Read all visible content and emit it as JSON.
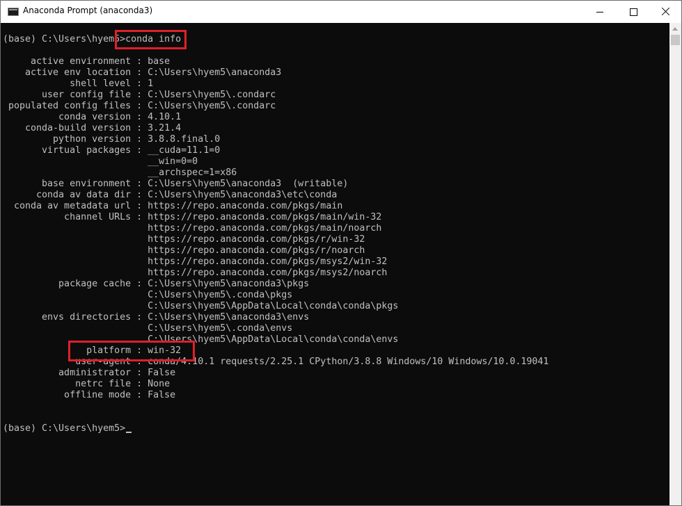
{
  "window": {
    "title": "Anaconda Prompt (anaconda3)",
    "icon": "terminal-icon",
    "controls": {
      "minimize": "minimize-icon",
      "maximize": "maximize-icon",
      "close": "close-icon"
    }
  },
  "console": {
    "lines": [
      "(base) C:\\Users\\hyem5>conda info",
      "",
      "     active environment : base",
      "    active env location : C:\\Users\\hyem5\\anaconda3",
      "            shell level : 1",
      "       user config file : C:\\Users\\hyem5\\.condarc",
      " populated config files : C:\\Users\\hyem5\\.condarc",
      "          conda version : 4.10.1",
      "    conda-build version : 3.21.4",
      "         python version : 3.8.8.final.0",
      "       virtual packages : __cuda=11.1=0",
      "                          __win=0=0",
      "                          __archspec=1=x86",
      "       base environment : C:\\Users\\hyem5\\anaconda3  (writable)",
      "      conda av data dir : C:\\Users\\hyem5\\anaconda3\\etc\\conda",
      "  conda av metadata url : https://repo.anaconda.com/pkgs/main",
      "           channel URLs : https://repo.anaconda.com/pkgs/main/win-32",
      "                          https://repo.anaconda.com/pkgs/main/noarch",
      "                          https://repo.anaconda.com/pkgs/r/win-32",
      "                          https://repo.anaconda.com/pkgs/r/noarch",
      "                          https://repo.anaconda.com/pkgs/msys2/win-32",
      "                          https://repo.anaconda.com/pkgs/msys2/noarch",
      "          package cache : C:\\Users\\hyem5\\anaconda3\\pkgs",
      "                          C:\\Users\\hyem5\\.conda\\pkgs",
      "                          C:\\Users\\hyem5\\AppData\\Local\\conda\\conda\\pkgs",
      "       envs directories : C:\\Users\\hyem5\\anaconda3\\envs",
      "                          C:\\Users\\hyem5\\.conda\\envs",
      "                          C:\\Users\\hyem5\\AppData\\Local\\conda\\conda\\envs",
      "               platform : win-32",
      "             user-agent : conda/4.10.1 requests/2.25.1 CPython/3.8.8 Windows/10 Windows/10.0.19041",
      "          administrator : False",
      "             netrc file : None",
      "           offline mode : False",
      "",
      "",
      "(base) C:\\Users\\hyem5>"
    ]
  },
  "highlight_color": "#e0202a"
}
